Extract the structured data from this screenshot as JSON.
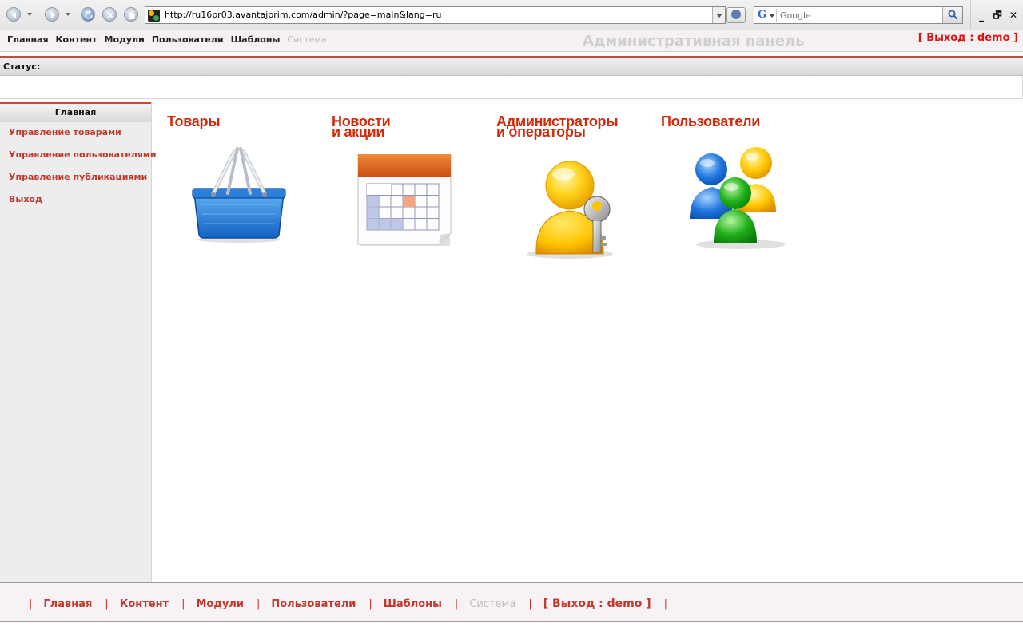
{
  "browser": {
    "url": "http://ru16pr03.avantajprim.com/admin/?page=main&lang=ru",
    "search_placeholder": "Google",
    "search_engine_letter": "G"
  },
  "topnav": {
    "items": [
      "Главная",
      "Контент",
      "Модули",
      "Пользователи",
      "Шаблоны"
    ],
    "disabled_item": "Система",
    "panel_title": "Административная панель",
    "logout": "[ Выход : demo ]"
  },
  "status": {
    "label": "Статус:"
  },
  "sidebar": {
    "header": "Главная",
    "items": [
      "Управление товарами",
      "Управление пользователями",
      "Управление публикациями",
      "Выход"
    ]
  },
  "tiles": [
    {
      "title_line1": "Товары",
      "title_line2": "",
      "icon": "basket-icon"
    },
    {
      "title_line1": "Новости",
      "title_line2": "и акции",
      "icon": "calendar-icon"
    },
    {
      "title_line1": "Администраторы",
      "title_line2": "и операторы",
      "icon": "admin-key-icon"
    },
    {
      "title_line1": "Пользователи",
      "title_line2": "",
      "icon": "users-group-icon"
    }
  ],
  "footer": {
    "items": [
      "Главная",
      "Контент",
      "Модули",
      "Пользователи",
      "Шаблоны"
    ],
    "disabled_item": "Система",
    "logout": "[ Выход : demo ]"
  },
  "colors": {
    "accent_red": "#c0392b",
    "title_red": "#d32a0c",
    "logout_red": "#e01010",
    "disabled_gray": "#b8b8b8"
  }
}
